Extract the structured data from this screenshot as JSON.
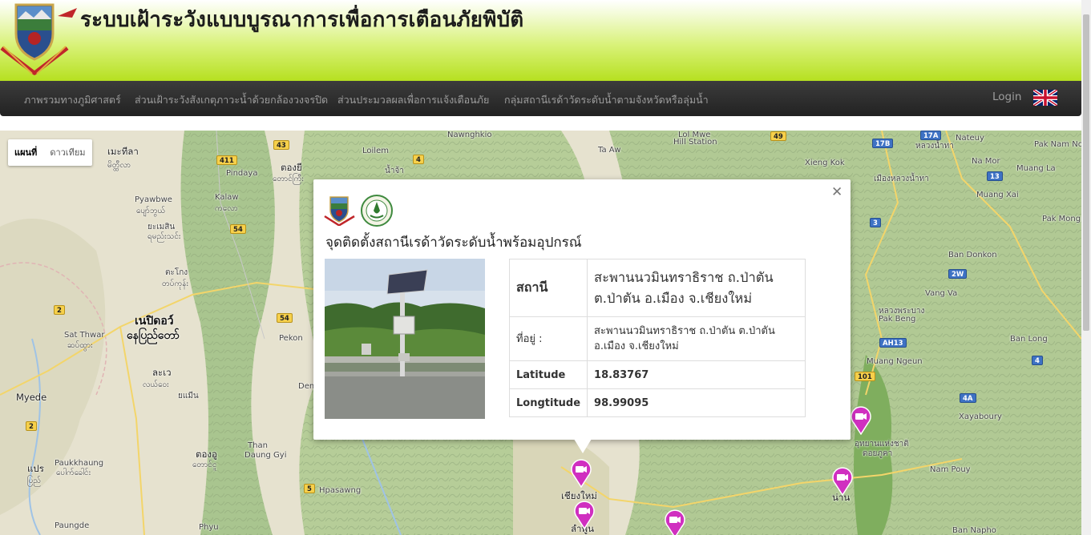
{
  "header": {
    "title": "ระบบเฝ้าระวังแบบบูรณาการเพื่อการเตือนภัยพิบัติ"
  },
  "nav": {
    "items": [
      {
        "label": "ภาพรวมทางภูมิศาสตร์"
      },
      {
        "label": "ส่วนเฝ้าระวังสังเกตุภาวะน้ำด้วยกล้องวงจรปิด"
      },
      {
        "label": "ส่วนประมวลผลเพื่อการแจ้งเตือนภัย"
      },
      {
        "label": "กลุ่มสถานีเรด้าวัดระดับน้ำตามจังหวัดหรือลุ่มน้ำ"
      }
    ],
    "login": "Login",
    "flag_icon": "uk-flag-icon"
  },
  "map": {
    "type_buttons": [
      "แผนที่",
      "ดาวเทียม"
    ],
    "active_type": "แผนที่",
    "labels": [
      {
        "text": "เมะทีลา"
      },
      {
        "text": "မိတ္ထီလာ"
      },
      {
        "text": "Pyawbwe"
      },
      {
        "text": "ပျော်ဘွယ်"
      },
      {
        "text": "ยะเมสิน"
      },
      {
        "text": "ရမည်းသင်း"
      },
      {
        "text": "ตะโกง"
      },
      {
        "text": "တပ်ကုန်း"
      },
      {
        "text": "เนปิดอว์"
      },
      {
        "text": "နေပြည်တော်"
      },
      {
        "text": "Sat Thwar"
      },
      {
        "text": "ဆပ်ထွား"
      },
      {
        "text": "ละเว"
      },
      {
        "text": "လယ်ဝေး"
      },
      {
        "text": "Myede"
      },
      {
        "text": "ยแมีน"
      },
      {
        "text": "ยแมีน"
      },
      {
        "text": "Pindaya"
      },
      {
        "text": "Kalaw"
      },
      {
        "text": "ကလော"
      },
      {
        "text": "ตองยี"
      },
      {
        "text": "တောင်ကြီး"
      },
      {
        "text": "Loilem"
      },
      {
        "text": "Nawnghkio"
      },
      {
        "text": "Pekon"
      },
      {
        "text": "Dem"
      },
      {
        "text": "Than"
      },
      {
        "text": "Daung Gyi"
      },
      {
        "text": "ตองอู"
      },
      {
        "text": "တောင်ငူ"
      },
      {
        "text": "Paukkhaung"
      },
      {
        "text": "ပေါက်ခေါင်း"
      },
      {
        "text": "แปร"
      },
      {
        "text": "ပြည်"
      },
      {
        "text": "Paungde"
      },
      {
        "text": "Phyu"
      },
      {
        "text": "Hpasawng"
      },
      {
        "text": "Lol Mwe"
      },
      {
        "text": "Hill Station"
      },
      {
        "text": "Ta Aw"
      },
      {
        "text": "Xieng Kok"
      },
      {
        "text": "Nateuy"
      },
      {
        "text": "Pak Nam Noy"
      },
      {
        "text": "Na Mor"
      },
      {
        "text": "Muang La"
      },
      {
        "text": "Muang Xai"
      },
      {
        "text": "Pak Mong"
      },
      {
        "text": "Ban Donkon"
      },
      {
        "text": "Vang Va"
      },
      {
        "text": "Pak Beng"
      },
      {
        "text": "Ban Long"
      },
      {
        "text": "Muang Ngeun"
      },
      {
        "text": "Xayaboury"
      },
      {
        "text": "Nam Pouy"
      },
      {
        "text": "Ban Napho"
      },
      {
        "text": "เชียงใหม่"
      },
      {
        "text": "ลำพูน"
      },
      {
        "text": "น่าน"
      },
      {
        "text": "หลวงพระบาง"
      },
      {
        "text": "อุทยานแห่งชาติ"
      },
      {
        "text": "ดอยภูคา"
      },
      {
        "text": "เมืองหลวงน้ำทา"
      },
      {
        "text": "หลวงน้ำทา"
      },
      {
        "text": "น้ำจ้า"
      }
    ],
    "shields": [
      {
        "text": "43"
      },
      {
        "text": "411"
      },
      {
        "text": "4"
      },
      {
        "text": "49"
      },
      {
        "text": "54"
      },
      {
        "text": "2"
      },
      {
        "text": "54"
      },
      {
        "text": "2"
      },
      {
        "text": "5"
      },
      {
        "text": "17B"
      },
      {
        "text": "13"
      },
      {
        "text": "3"
      },
      {
        "text": "2W"
      },
      {
        "text": "AH13"
      },
      {
        "text": "4"
      },
      {
        "text": "101"
      },
      {
        "text": "4A"
      },
      {
        "text": "17A"
      }
    ],
    "markers_icon": "camera-marker-icon"
  },
  "popup": {
    "title": "จุดติดตั้งสถานีเรด้าวัดระดับน้ำพร้อมอุปกรณ์",
    "close_icon": "close-icon",
    "rows": {
      "station_label": "สถานี",
      "station_value": "สะพานนวมินทราธิราช ถ.ป่าตัน ต.ป่าตัน อ.เมือง จ.เชียงใหม่",
      "address_label": "ที่อยู่ :",
      "address_value": "สะพานนวมินทราธิราช ถ.ป่าตัน ต.ป่าตัน อ.เมือง จ.เชียงใหม่",
      "latitude_label": "Latitude",
      "latitude_value": "18.83767",
      "longitude_label": "Longtitude",
      "longitude_value": "98.99095"
    }
  }
}
